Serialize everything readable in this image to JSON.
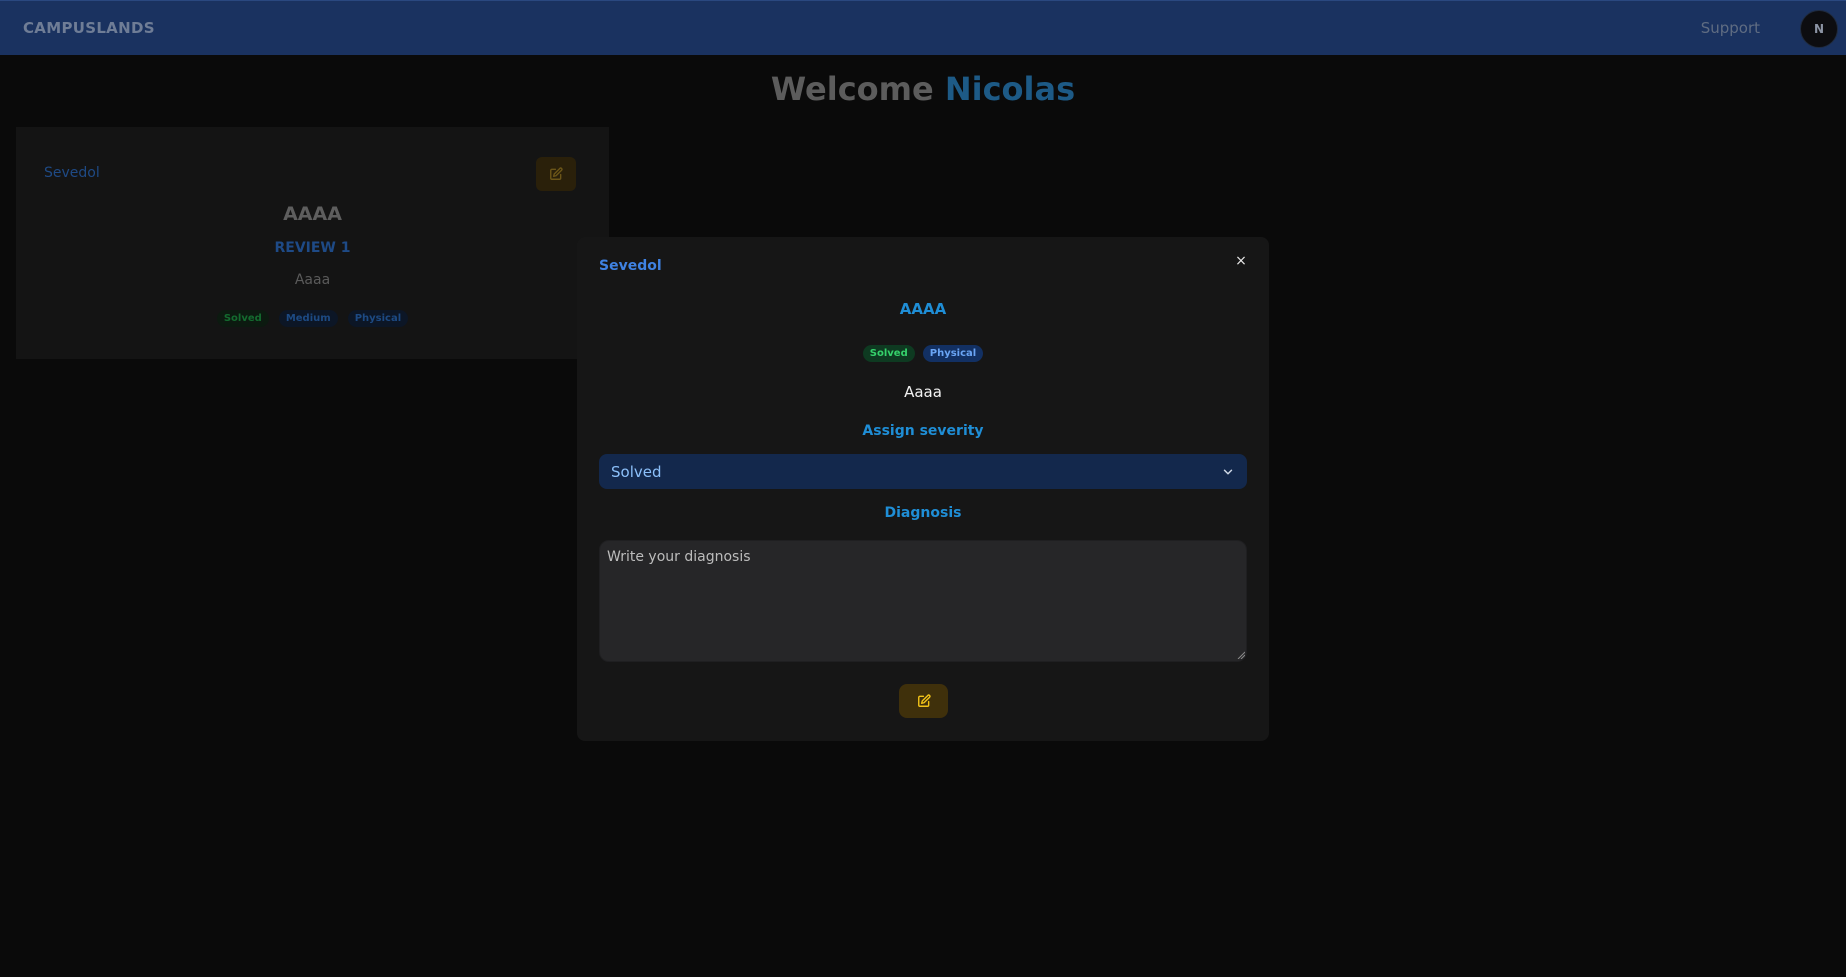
{
  "navbar": {
    "brand": "CAMPUSLANDS",
    "support_label": "Support",
    "avatar_initial": "N"
  },
  "welcome": {
    "prefix": "Welcome",
    "name": "Nicolas"
  },
  "card": {
    "user": "Sevedol",
    "title": "AAAA",
    "review": "REVIEW 1",
    "description": "Aaaa",
    "tags": [
      "Solved",
      "Medium",
      "Physical"
    ],
    "edit_icon": "edit-icon"
  },
  "modal": {
    "user": "Sevedol",
    "close_label": "×",
    "title": "AAAA",
    "tags": [
      "Solved",
      "Physical"
    ],
    "description": "Aaaa",
    "severity_label": "Assign severity",
    "severity_value": "Solved",
    "diagnosis_label": "Diagnosis",
    "diagnosis_placeholder": "Write your diagnosis",
    "save_icon": "edit-icon"
  },
  "colors": {
    "navbar": "#1a3260",
    "accent_blue": "#1f8ed6",
    "status_green": "#35d16b",
    "edit_yellow": "#f2c318"
  }
}
